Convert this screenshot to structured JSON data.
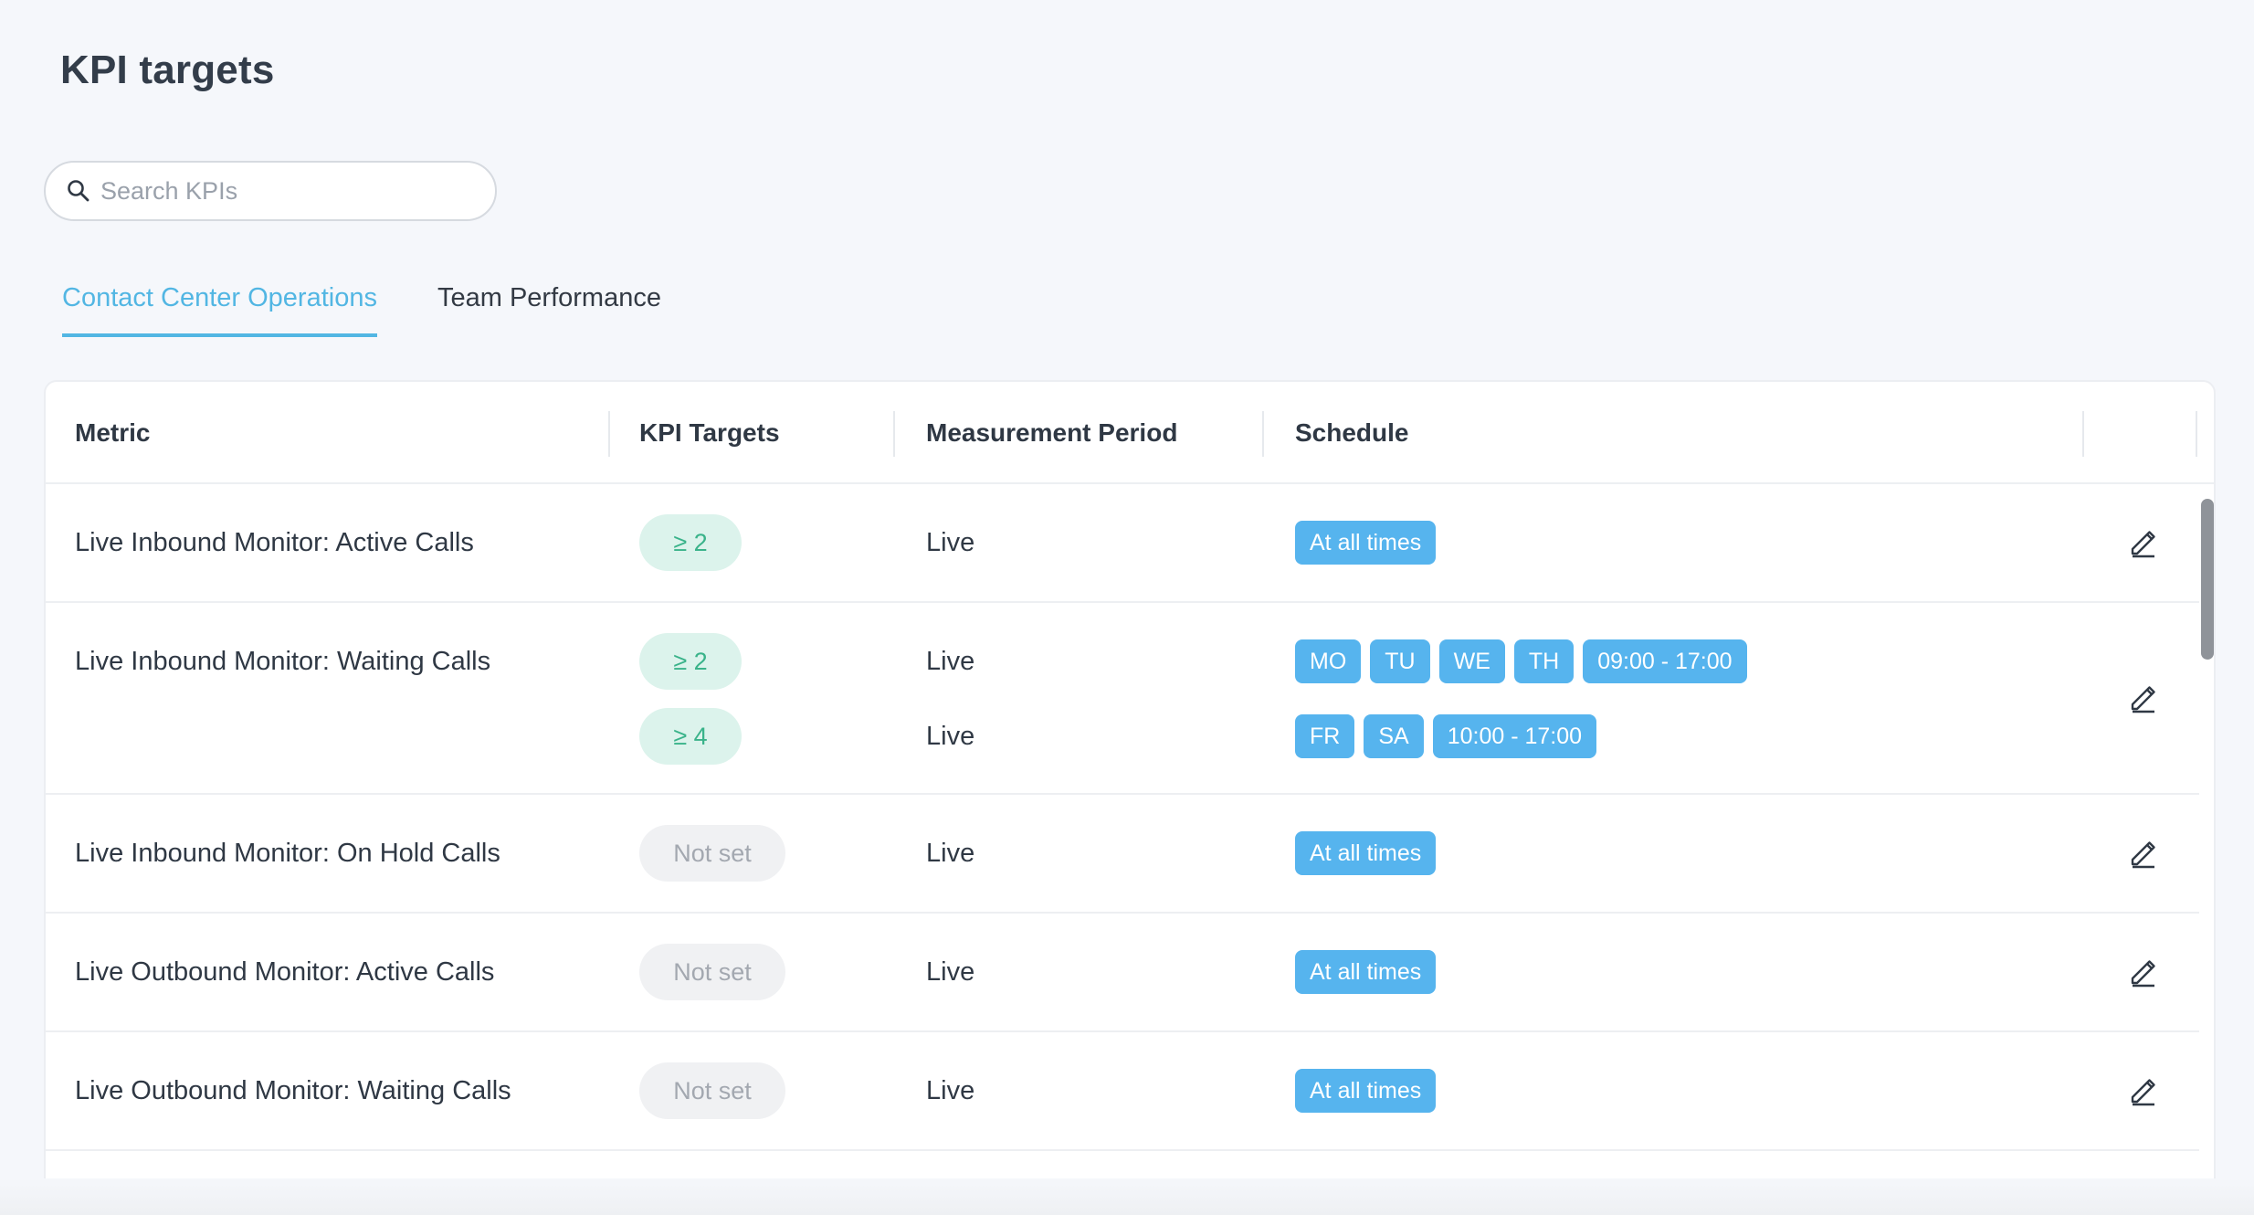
{
  "page": {
    "title": "KPI targets"
  },
  "search": {
    "placeholder": "Search KPIs",
    "icon": "search-icon"
  },
  "tabs": [
    {
      "label": "Contact Center Operations",
      "active": true
    },
    {
      "label": "Team Performance",
      "active": false
    }
  ],
  "table": {
    "headers": {
      "metric": "Metric",
      "kpi_targets": "KPI Targets",
      "measurement_period": "Measurement Period",
      "schedule": "Schedule"
    },
    "rows": [
      {
        "metric": "Live Inbound Monitor: Active Calls",
        "targets": [
          {
            "kpi": "≥ 2",
            "period": "Live",
            "schedule": [
              "At all times"
            ]
          }
        ]
      },
      {
        "metric": "Live Inbound Monitor: Waiting Calls",
        "targets": [
          {
            "kpi": "≥ 2",
            "period": "Live",
            "schedule": [
              "MO",
              "TU",
              "WE",
              "TH",
              "09:00 - 17:00"
            ]
          },
          {
            "kpi": "≥ 4",
            "period": "Live",
            "schedule": [
              "FR",
              "SA",
              "10:00 - 17:00"
            ]
          }
        ]
      },
      {
        "metric": "Live Inbound Monitor: On Hold Calls",
        "targets": [
          {
            "kpi": "Not set",
            "period": "Live",
            "schedule": [
              "At all times"
            ]
          }
        ]
      },
      {
        "metric": "Live Outbound Monitor: Active Calls",
        "targets": [
          {
            "kpi": "Not set",
            "period": "Live",
            "schedule": [
              "At all times"
            ]
          }
        ]
      },
      {
        "metric": "Live Outbound Monitor: Waiting Calls",
        "targets": [
          {
            "kpi": "Not set",
            "period": "Live",
            "schedule": [
              "At all times"
            ]
          }
        ]
      }
    ]
  },
  "icons": {
    "row_action": "pencil-edit-icon"
  },
  "colors": {
    "accent": "#52b6e3",
    "chip": "#56b4ee",
    "kpi_set_bg": "#dcf3ec",
    "kpi_set_text": "#3ab38a",
    "kpi_unset_bg": "#f0f1f3",
    "kpi_unset_text": "#a3a8b0"
  }
}
